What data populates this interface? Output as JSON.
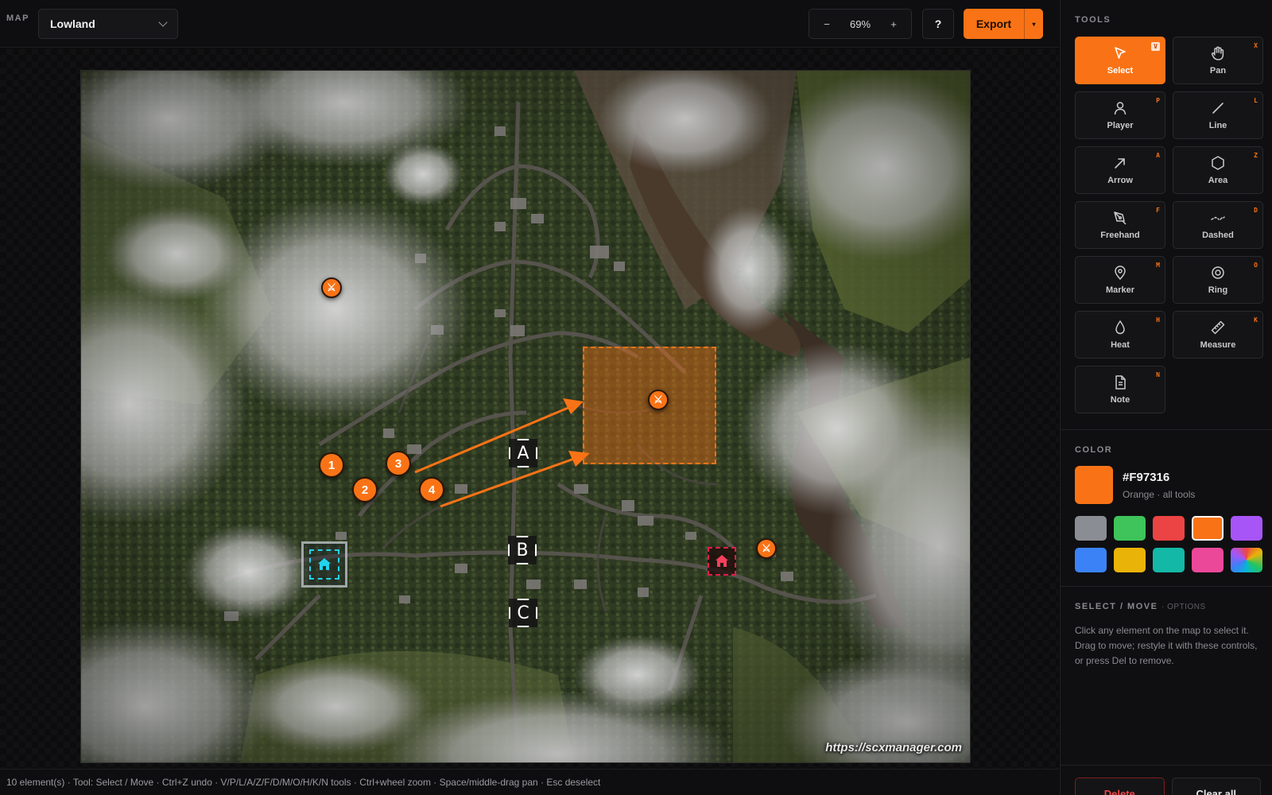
{
  "topbar": {
    "map_label": "MAP",
    "map_value": "Lowland",
    "zoom_minus": "−",
    "zoom_value": "69%",
    "zoom_plus": "+",
    "help": "?",
    "export": "Export",
    "export_caret": "▾"
  },
  "map": {
    "watermark": "https://scxmanager.com",
    "markers": {
      "num1": "1",
      "num2": "2",
      "num3": "3",
      "num4": "4",
      "siteA": "A",
      "siteB": "B",
      "siteC": "C",
      "cross": "⚔"
    }
  },
  "status": "10 element(s) · Tool: Select / Move · Ctrl+Z undo · V/P/L/A/Z/F/D/M/O/H/K/N tools · Ctrl+wheel zoom · Space/middle-drag pan · Esc deselect",
  "tools": {
    "title": "TOOLS",
    "items": [
      {
        "label": "Select",
        "key": "V",
        "icon": "cursor-icon"
      },
      {
        "label": "Pan",
        "key": "X",
        "icon": "hand-icon"
      },
      {
        "label": "Player",
        "key": "P",
        "icon": "person-icon"
      },
      {
        "label": "Line",
        "key": "L",
        "icon": "line-icon"
      },
      {
        "label": "Arrow",
        "key": "A",
        "icon": "arrow-icon"
      },
      {
        "label": "Area",
        "key": "Z",
        "icon": "hexagon-icon"
      },
      {
        "label": "Freehand",
        "key": "F",
        "icon": "pen-icon"
      },
      {
        "label": "Dashed",
        "key": "D",
        "icon": "dashed-line-icon"
      },
      {
        "label": "Marker",
        "key": "M",
        "icon": "map-pin-icon"
      },
      {
        "label": "Ring",
        "key": "O",
        "icon": "ring-icon"
      },
      {
        "label": "Heat",
        "key": "H",
        "icon": "droplet-icon"
      },
      {
        "label": "Measure",
        "key": "K",
        "icon": "ruler-icon"
      },
      {
        "label": "Note",
        "key": "N",
        "icon": "note-icon"
      }
    ]
  },
  "color": {
    "title": "COLOR",
    "hex": "#F97316",
    "subtitle": "Orange · all tools",
    "current": "#f97316",
    "swatches": [
      "#8b8d94",
      "#3ec45a",
      "#ec4444",
      "#f97316",
      "#a855f7",
      "#3b82f6",
      "#eab308",
      "#14b8a6",
      "#ec4899",
      "rainbow"
    ]
  },
  "options": {
    "title": "SELECT / MOVE",
    "subtitle": "· OPTIONS",
    "text": "Click any element on the map to select it. Drag to move; restyle it with these controls, or press Del to remove."
  },
  "actions": {
    "delete": "Delete",
    "clear": "Clear all"
  }
}
